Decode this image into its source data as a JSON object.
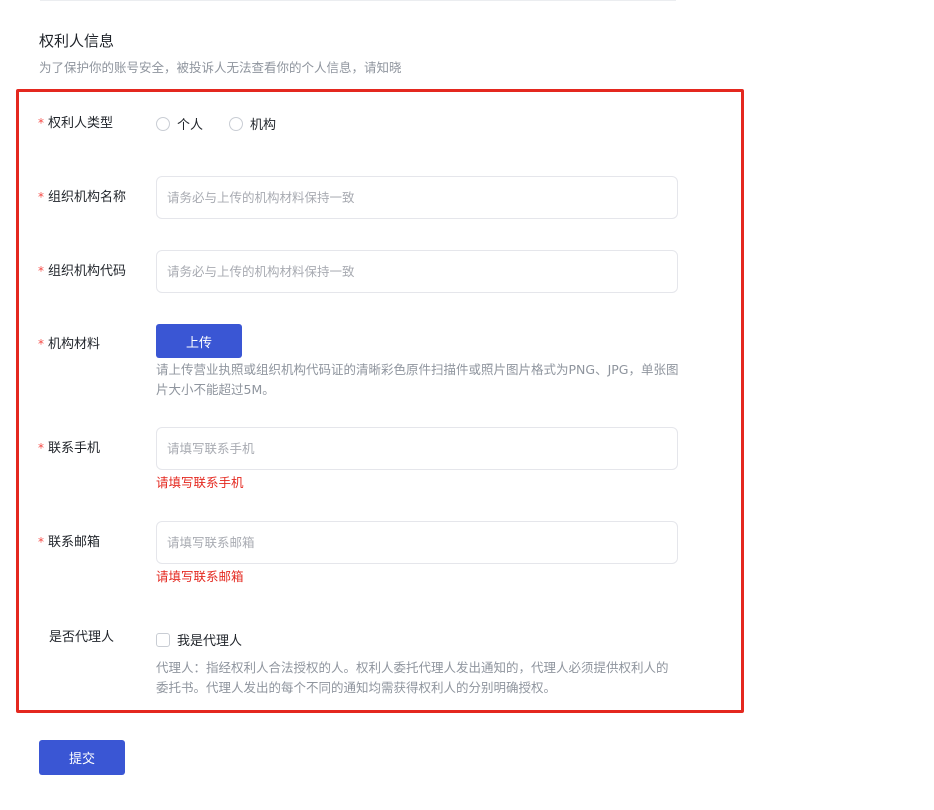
{
  "section": {
    "title": "权利人信息",
    "description": "为了保护你的账号安全，被投诉人无法查看你的个人信息，请知晓"
  },
  "form": {
    "required_mark": "*",
    "rightholder_type": {
      "label": "权利人类型",
      "options": [
        "个人",
        "机构"
      ]
    },
    "org_name": {
      "label": "组织机构名称",
      "placeholder": "请务必与上传的机构材料保持一致"
    },
    "org_code": {
      "label": "组织机构代码",
      "placeholder": "请务必与上传的机构材料保持一致"
    },
    "org_material": {
      "label": "机构材料",
      "button": "上传",
      "help": "请上传营业执照或组织机构代码证的清晰彩色原件扫描件或照片图片格式为PNG、JPG，单张图片大小不能超过5M。"
    },
    "phone": {
      "label": "联系手机",
      "placeholder": "请填写联系手机",
      "error": "请填写联系手机"
    },
    "email": {
      "label": "联系邮箱",
      "placeholder": "请填写联系邮箱",
      "error": "请填写联系邮箱"
    },
    "is_agent": {
      "label": "是否代理人",
      "checkbox_label": "我是代理人",
      "help": "代理人：指经权利人合法授权的人。权利人委托代理人发出通知的，代理人必须提供权利人的委托书。代理人发出的每个不同的通知均需获得权利人的分别明确授权。"
    },
    "submit": "提交"
  },
  "colors": {
    "primary": "#3a56d4",
    "error": "#e4281f",
    "required": "#f54a45",
    "highlight_border": "#e4281f"
  }
}
